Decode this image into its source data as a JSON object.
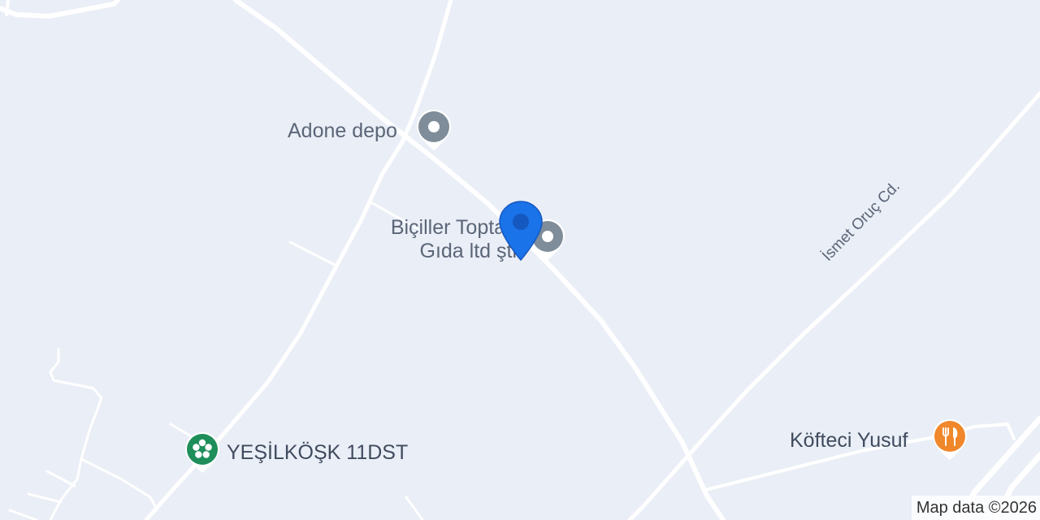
{
  "map": {
    "places": [
      {
        "name": "Adone depo",
        "icon": "generic-place-pin-icon",
        "color": "#7f8c99"
      },
      {
        "name_line1": "Biçiller Toptan",
        "name_line2": "Gıda ltd şti",
        "icon": "generic-place-pin-icon",
        "color": "#7f8c99"
      },
      {
        "name": "YEŞİLKÖŞK 11DST",
        "icon": "flower-pin-icon",
        "color": "#1e8e5a"
      },
      {
        "name": "Köfteci Yusuf",
        "icon": "restaurant-pin-icon",
        "color": "#f0872a"
      }
    ],
    "street": "İsmet Oruç Cd.",
    "selected_marker": {
      "icon": "location-marker-icon",
      "color": "#1a73e8"
    },
    "attribution": "Map data ©2026"
  }
}
